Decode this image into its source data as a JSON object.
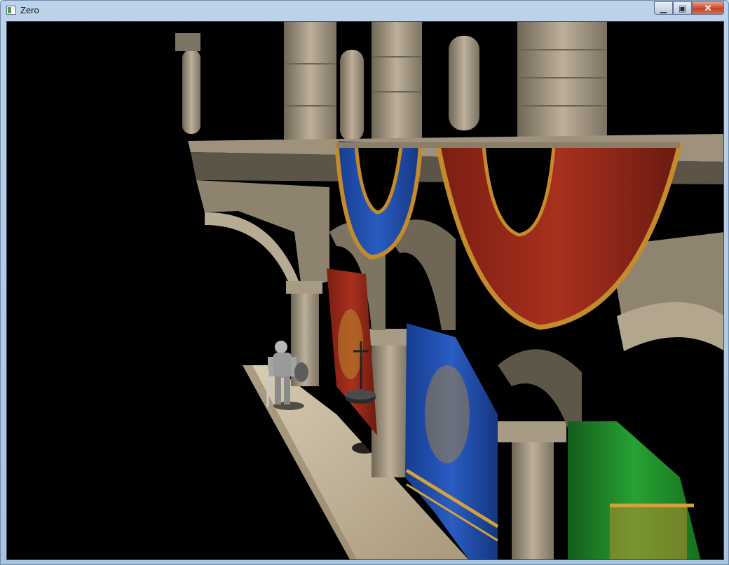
{
  "window": {
    "title": "Zero",
    "app_icon": "app-window-icon",
    "controls": {
      "minimize": "minimize-icon",
      "maximize": "maximize-icon",
      "close": "close-icon"
    }
  },
  "scene": {
    "description_kind": "3d-rendered-game-viewport",
    "colors": {
      "background": "#000000",
      "stone": "#b9ad98",
      "banner_blue": "#1d49a6",
      "banner_red": "#9b2a1c",
      "banner_green": "#1f8a2a",
      "trim_gold": "#b98a2e"
    }
  }
}
